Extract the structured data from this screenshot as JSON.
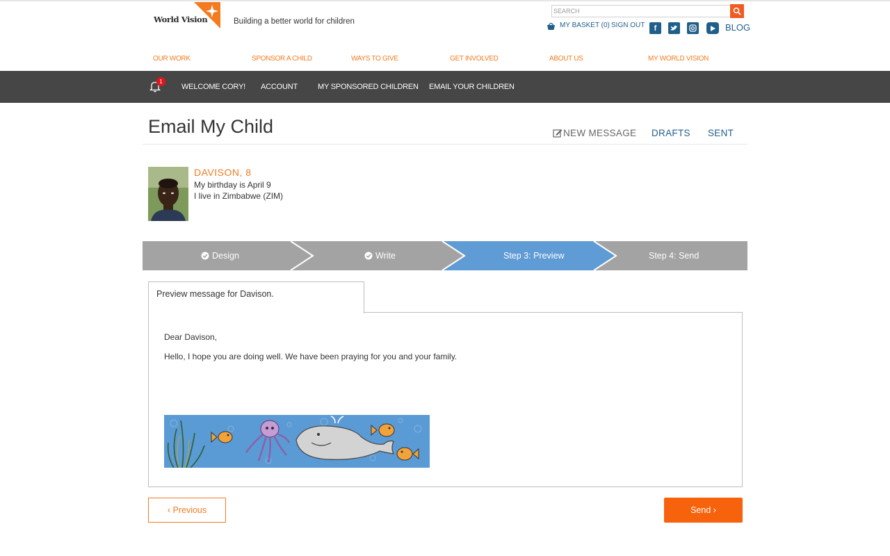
{
  "header": {
    "logo_text": "World Vision",
    "tagline": "Building a better world for children",
    "search_placeholder": "SEARCH",
    "basket": "MY BASKET (0)",
    "sign_out": "SIGN OUT",
    "blog": "BLOG",
    "social_icons": [
      "facebook-icon",
      "twitter-icon",
      "instagram-icon",
      "youtube-icon"
    ]
  },
  "main_nav": [
    "OUR WORK",
    "SPONSOR A CHILD",
    "WAYS TO GIVE",
    "GET INVOLVED",
    "ABOUT US",
    "MY WORLD VISION"
  ],
  "user_bar": {
    "notification_count": "1",
    "links": [
      "WELCOME CORY!",
      "ACCOUNT",
      "MY SPONSORED CHILDREN",
      "EMAIL YOUR CHILDREN"
    ]
  },
  "page": {
    "title": "Email My Child",
    "tabs": {
      "new_message": "NEW MESSAGE",
      "drafts": "DRAFTS",
      "sent": "SENT"
    }
  },
  "child": {
    "name": "DAVISON, 8",
    "birthday": "My birthday is April 9",
    "location": "I live in Zimbabwe (ZIM)"
  },
  "steps": [
    {
      "label": "Design",
      "state": "done"
    },
    {
      "label": "Write",
      "state": "done"
    },
    {
      "label": "Step 3: Preview",
      "state": "active"
    },
    {
      "label": "Step 4: Send",
      "state": "pending"
    }
  ],
  "preview": {
    "tab_label": "Preview message for Davison.",
    "greeting": "Dear Davison,",
    "body": "Hello, I hope you are doing well. We have been praying for you and your family."
  },
  "buttons": {
    "previous": "‹ Previous",
    "send": "Send ›"
  },
  "colors": {
    "orange": "#f47b20",
    "blue": "#1f5f8b",
    "active_step": "#5f9bd4",
    "dark_bar": "#464646",
    "send_button": "#f7630c"
  }
}
